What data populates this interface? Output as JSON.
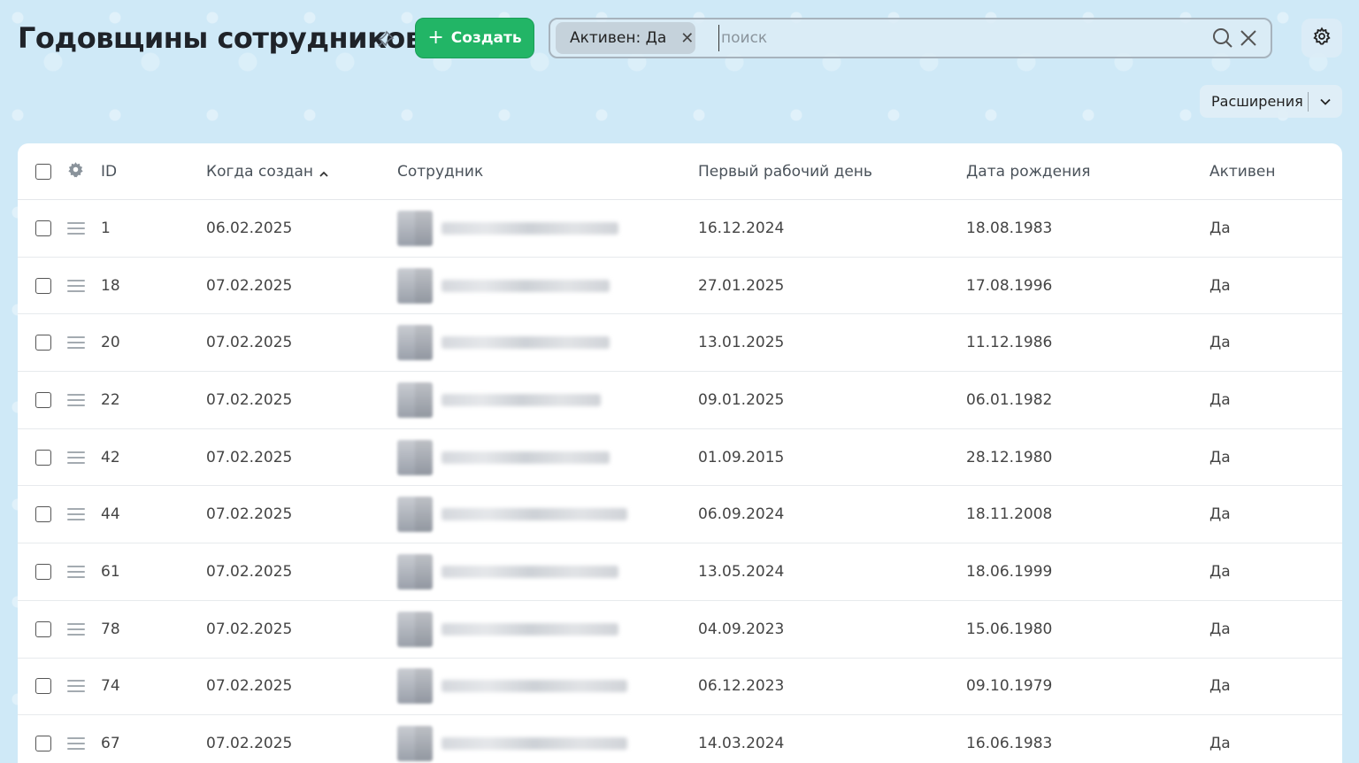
{
  "header": {
    "title": "Годовщины сотрудников",
    "create_label": "Создать",
    "filter_chip_label": "Активен: Да",
    "search_placeholder": "поиск",
    "extensions_label": "Расширения"
  },
  "colors": {
    "background": "#cfe9f7",
    "accent_green": "#22b566"
  },
  "icons": [
    "pin-icon",
    "plus-icon",
    "close-icon",
    "search-icon",
    "gear-icon",
    "chevron-down-icon",
    "drag-handle-icon",
    "sort-asc-icon"
  ],
  "table": {
    "columns": {
      "id": "ID",
      "created": "Когда создан",
      "employee": "Сотрудник",
      "first_day": "Первый рабочий день",
      "birth": "Дата рождения",
      "active": "Активен"
    },
    "rows": [
      {
        "id": "1",
        "created": "06.02.2025",
        "first_day": "16.12.2024",
        "birth": "18.08.1983",
        "active": "Да"
      },
      {
        "id": "18",
        "created": "07.02.2025",
        "first_day": "27.01.2025",
        "birth": "17.08.1996",
        "active": "Да"
      },
      {
        "id": "20",
        "created": "07.02.2025",
        "first_day": "13.01.2025",
        "birth": "11.12.1986",
        "active": "Да"
      },
      {
        "id": "22",
        "created": "07.02.2025",
        "first_day": "09.01.2025",
        "birth": "06.01.1982",
        "active": "Да"
      },
      {
        "id": "42",
        "created": "07.02.2025",
        "first_day": "01.09.2015",
        "birth": "28.12.1980",
        "active": "Да"
      },
      {
        "id": "44",
        "created": "07.02.2025",
        "first_day": "06.09.2024",
        "birth": "18.11.2008",
        "active": "Да"
      },
      {
        "id": "61",
        "created": "07.02.2025",
        "first_day": "13.05.2024",
        "birth": "18.06.1999",
        "active": "Да"
      },
      {
        "id": "78",
        "created": "07.02.2025",
        "first_day": "04.09.2023",
        "birth": "15.06.1980",
        "active": "Да"
      },
      {
        "id": "74",
        "created": "07.02.2025",
        "first_day": "06.12.2023",
        "birth": "09.10.1979",
        "active": "Да"
      },
      {
        "id": "67",
        "created": "07.02.2025",
        "first_day": "14.03.2024",
        "birth": "16.06.1983",
        "active": "Да"
      }
    ]
  }
}
